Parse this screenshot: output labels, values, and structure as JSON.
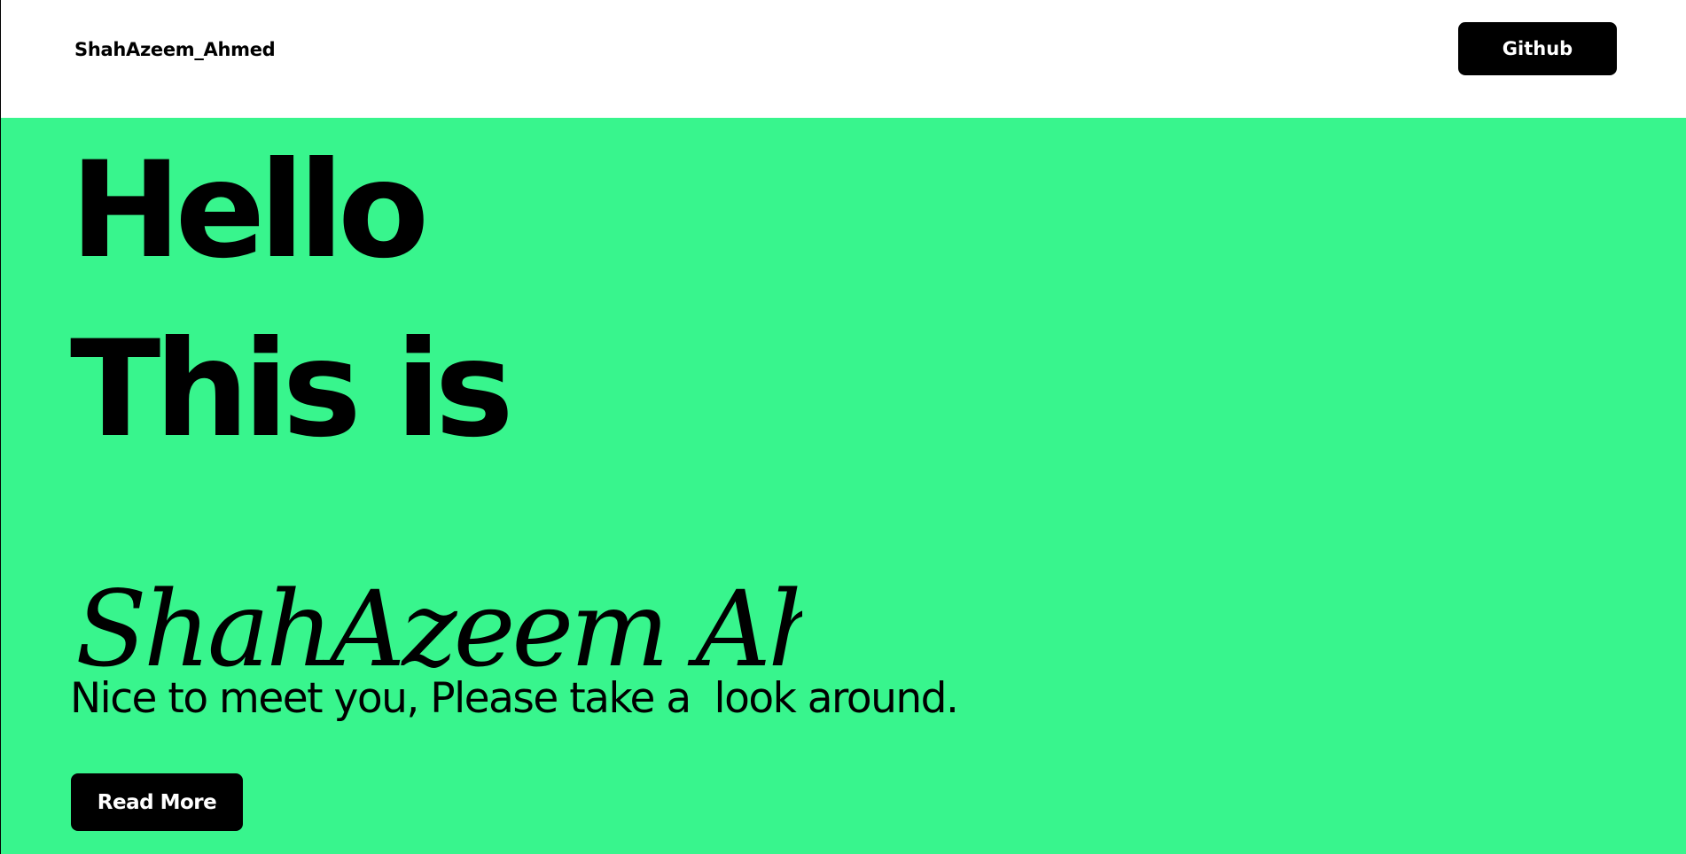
{
  "header": {
    "brand": "ShahAzeem_Ahmed",
    "github_label": "Github"
  },
  "hero": {
    "line1": "Hello",
    "line2": "This is",
    "signature": "ShahAzeem Ahmed",
    "tagline": "Nice to meet you, Please take a  look around.",
    "read_more_label": "Read More"
  },
  "colors": {
    "hero_background": "#38f58d",
    "header_background": "#ffffff",
    "button_background": "#000000",
    "button_text": "#ffffff",
    "text": "#000000"
  }
}
